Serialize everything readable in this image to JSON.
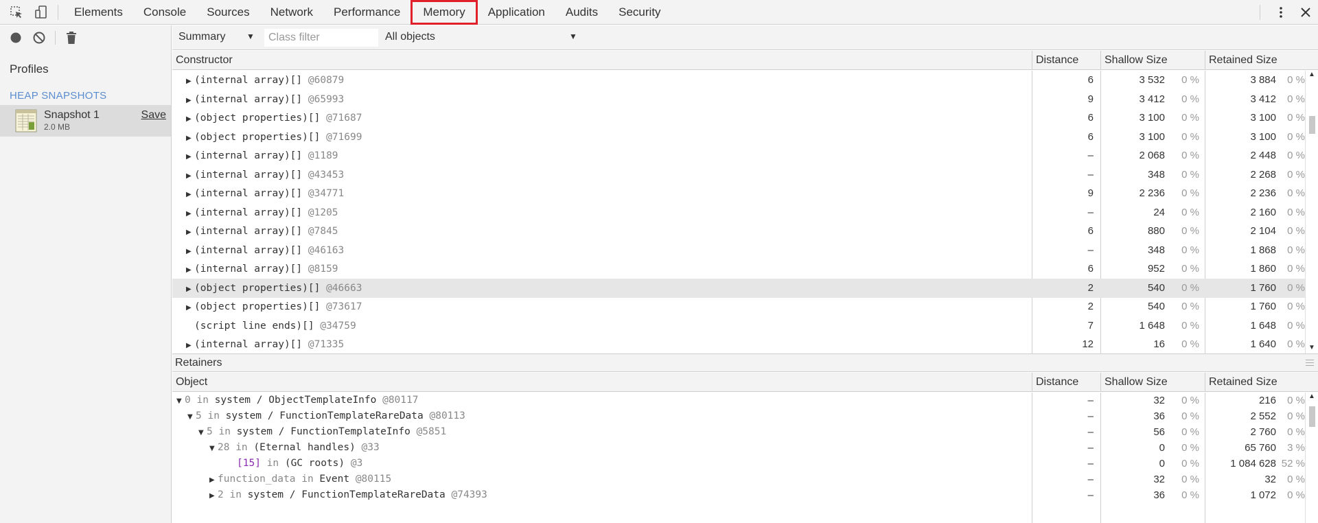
{
  "tabs": {
    "items": [
      {
        "label": "Elements"
      },
      {
        "label": "Console"
      },
      {
        "label": "Sources"
      },
      {
        "label": "Network"
      },
      {
        "label": "Performance"
      },
      {
        "label": "Memory",
        "active": true
      },
      {
        "label": "Application"
      },
      {
        "label": "Audits"
      },
      {
        "label": "Security"
      }
    ],
    "active_outline_color": "#e0202a"
  },
  "sidebar": {
    "profiles_title": "Profiles",
    "heap_snapshots_title": "HEAP SNAPSHOTS",
    "snapshot": {
      "name": "Snapshot 1",
      "size": "2.0 MB",
      "save_label": "Save"
    },
    "heading_color": "#5a8dd0"
  },
  "toolbar": {
    "view_select": "Summary",
    "class_filter_placeholder": "Class filter",
    "objects_select": "All objects"
  },
  "constructors": {
    "columns": {
      "name": "Constructor",
      "distance": "Distance",
      "shallow": "Shallow Size",
      "retained": "Retained Size"
    },
    "rows": [
      {
        "name": "(internal array)[]",
        "id": "@60879",
        "distance": "6",
        "shallow": "3 532",
        "shallow_pct": "0 %",
        "retained": "3 884",
        "retained_pct": "0 %",
        "expandable": true
      },
      {
        "name": "(internal array)[]",
        "id": "@65993",
        "distance": "9",
        "shallow": "3 412",
        "shallow_pct": "0 %",
        "retained": "3 412",
        "retained_pct": "0 %",
        "expandable": true
      },
      {
        "name": "(object properties)[]",
        "id": "@71687",
        "distance": "6",
        "shallow": "3 100",
        "shallow_pct": "0 %",
        "retained": "3 100",
        "retained_pct": "0 %",
        "expandable": true
      },
      {
        "name": "(object properties)[]",
        "id": "@71699",
        "distance": "6",
        "shallow": "3 100",
        "shallow_pct": "0 %",
        "retained": "3 100",
        "retained_pct": "0 %",
        "expandable": true
      },
      {
        "name": "(internal array)[]",
        "id": "@1189",
        "distance": "–",
        "shallow": "2 068",
        "shallow_pct": "0 %",
        "retained": "2 448",
        "retained_pct": "0 %",
        "expandable": true
      },
      {
        "name": "(internal array)[]",
        "id": "@43453",
        "distance": "–",
        "shallow": "348",
        "shallow_pct": "0 %",
        "retained": "2 268",
        "retained_pct": "0 %",
        "expandable": true
      },
      {
        "name": "(internal array)[]",
        "id": "@34771",
        "distance": "9",
        "shallow": "2 236",
        "shallow_pct": "0 %",
        "retained": "2 236",
        "retained_pct": "0 %",
        "expandable": true
      },
      {
        "name": "(internal array)[]",
        "id": "@1205",
        "distance": "–",
        "shallow": "24",
        "shallow_pct": "0 %",
        "retained": "2 160",
        "retained_pct": "0 %",
        "expandable": true
      },
      {
        "name": "(internal array)[]",
        "id": "@7845",
        "distance": "6",
        "shallow": "880",
        "shallow_pct": "0 %",
        "retained": "2 104",
        "retained_pct": "0 %",
        "expandable": true
      },
      {
        "name": "(internal array)[]",
        "id": "@46163",
        "distance": "–",
        "shallow": "348",
        "shallow_pct": "0 %",
        "retained": "1 868",
        "retained_pct": "0 %",
        "expandable": true
      },
      {
        "name": "(internal array)[]",
        "id": "@8159",
        "distance": "6",
        "shallow": "952",
        "shallow_pct": "0 %",
        "retained": "1 860",
        "retained_pct": "0 %",
        "expandable": true
      },
      {
        "name": "(object properties)[]",
        "id": "@46663",
        "distance": "2",
        "shallow": "540",
        "shallow_pct": "0 %",
        "retained": "1 760",
        "retained_pct": "0 %",
        "expandable": true,
        "selected": true
      },
      {
        "name": "(object properties)[]",
        "id": "@73617",
        "distance": "2",
        "shallow": "540",
        "shallow_pct": "0 %",
        "retained": "1 760",
        "retained_pct": "0 %",
        "expandable": true
      },
      {
        "name": "(script line ends)[]",
        "id": "@34759",
        "distance": "7",
        "shallow": "1 648",
        "shallow_pct": "0 %",
        "retained": "1 648",
        "retained_pct": "0 %",
        "expandable": false
      },
      {
        "name": "(internal array)[]",
        "id": "@71335",
        "distance": "12",
        "shallow": "16",
        "shallow_pct": "0 %",
        "retained": "1 640",
        "retained_pct": "0 %",
        "expandable": true
      }
    ]
  },
  "retainers": {
    "title": "Retainers",
    "columns": {
      "name": "Object",
      "distance": "Distance",
      "shallow": "Shallow Size",
      "retained": "Retained Size"
    },
    "rows": [
      {
        "indent": 0,
        "open": true,
        "key": "0",
        "sep": " in ",
        "owner": "system / ObjectTemplateInfo",
        "id": "@80117",
        "key_style": "grey",
        "distance": "–",
        "shallow": "32",
        "shallow_pct": "0 %",
        "retained": "216",
        "retained_pct": "0 %"
      },
      {
        "indent": 1,
        "open": true,
        "key": "5",
        "sep": " in ",
        "owner": "system / FunctionTemplateRareData",
        "id": "@80113",
        "key_style": "grey",
        "distance": "–",
        "shallow": "36",
        "shallow_pct": "0 %",
        "retained": "2 552",
        "retained_pct": "0 %"
      },
      {
        "indent": 2,
        "open": true,
        "key": "5",
        "sep": " in ",
        "owner": "system / FunctionTemplateInfo",
        "id": "@5851",
        "key_style": "grey",
        "distance": "–",
        "shallow": "56",
        "shallow_pct": "0 %",
        "retained": "2 760",
        "retained_pct": "0 %"
      },
      {
        "indent": 3,
        "open": true,
        "key": "28",
        "sep": " in ",
        "owner": "(Eternal handles)",
        "id": "@33",
        "key_style": "grey",
        "distance": "–",
        "shallow": "0",
        "shallow_pct": "0 %",
        "retained": "65 760",
        "retained_pct": "3 %"
      },
      {
        "indent": 4,
        "open": null,
        "key": "[15]",
        "sep": " in ",
        "owner": "(GC roots)",
        "id": "@3",
        "key_style": "purple",
        "distance": "–",
        "shallow": "0",
        "shallow_pct": "0 %",
        "retained": "1 084 628",
        "retained_pct": "52 %"
      },
      {
        "indent": 3,
        "open": false,
        "key": "function_data",
        "sep": " in ",
        "owner": "Event",
        "id": "@80115",
        "key_style": "grey",
        "distance": "–",
        "shallow": "32",
        "shallow_pct": "0 %",
        "retained": "32",
        "retained_pct": "0 %"
      },
      {
        "indent": 3,
        "open": false,
        "key": "2",
        "sep": " in ",
        "owner": "system / FunctionTemplateRareData",
        "id": "@74393",
        "key_style": "grey",
        "distance": "–",
        "shallow": "36",
        "shallow_pct": "0 %",
        "retained": "1 072",
        "retained_pct": "0 %"
      }
    ]
  }
}
